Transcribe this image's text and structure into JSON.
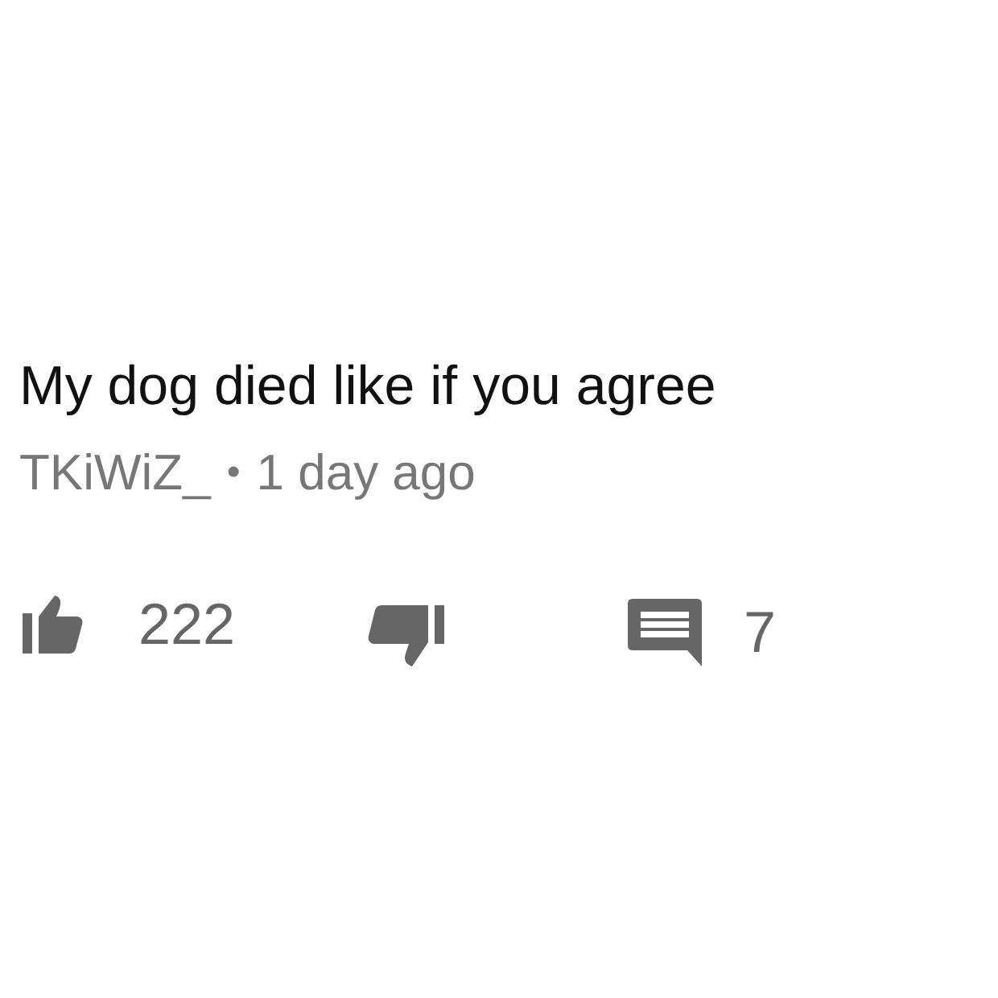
{
  "comment": {
    "text": "My dog died like if you agree",
    "author": "TKiWiZ_",
    "separator": "•",
    "time": "1 day ago"
  },
  "actions": {
    "likes": "222",
    "replies": "7"
  }
}
